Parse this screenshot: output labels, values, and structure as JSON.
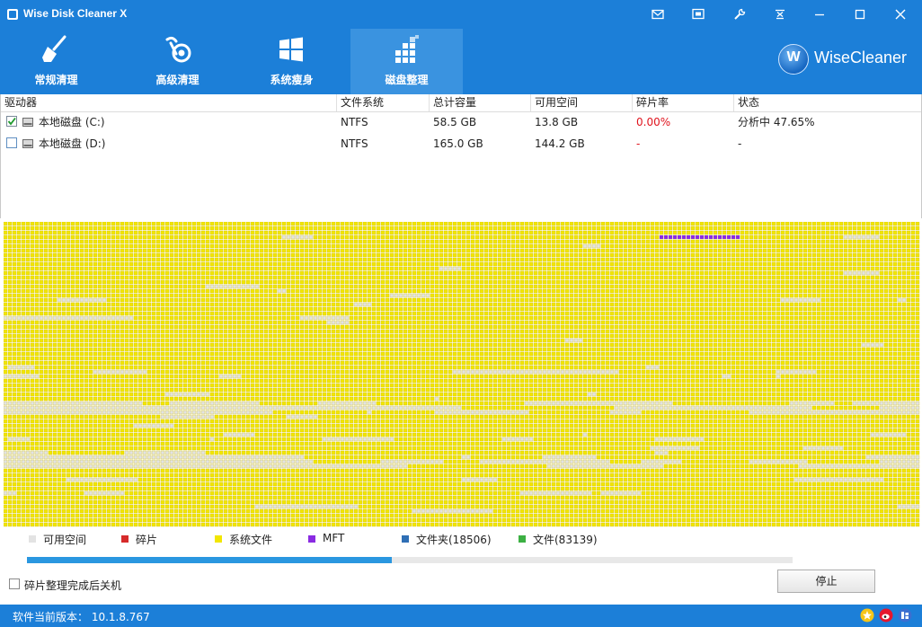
{
  "window": {
    "title": "Wise Disk Cleaner X",
    "controls": [
      "mail-icon",
      "feedback-icon",
      "tools-icon",
      "menu-icon",
      "minimize-icon",
      "maximize-icon",
      "close-icon"
    ]
  },
  "tabs": [
    {
      "label": "常规清理",
      "icon": "broom-icon",
      "active": false
    },
    {
      "label": "高级清理",
      "icon": "vacuum-icon",
      "active": false
    },
    {
      "label": "系统瘦身",
      "icon": "windows-icon",
      "active": false
    },
    {
      "label": "磁盘整理",
      "icon": "defrag-icon",
      "active": true
    }
  ],
  "brand": {
    "logo_letter": "W",
    "name": "WiseCleaner"
  },
  "table": {
    "columns": [
      "驱动器",
      "文件系统",
      "总计容量",
      "可用空间",
      "碎片率",
      "状态"
    ],
    "rows": [
      {
        "checked": true,
        "drive": "本地磁盘 (C:)",
        "fs": "NTFS",
        "total": "58.5 GB",
        "free": "13.8 GB",
        "frag": "0.00%",
        "status": "分析中 47.65%"
      },
      {
        "checked": false,
        "drive": "本地磁盘 (D:)",
        "fs": "NTFS",
        "total": "165.0 GB",
        "free": "144.2 GB",
        "frag": "-",
        "status": "-"
      }
    ]
  },
  "legend": [
    {
      "label": "可用空间",
      "color": "#e3e3e3"
    },
    {
      "label": "碎片",
      "color": "#d62b2b"
    },
    {
      "label": "系统文件",
      "color": "#f2e600"
    },
    {
      "label": "MFT",
      "color": "#8a2be2"
    },
    {
      "label": "文件夹(18506)",
      "color": "#2f6fb5"
    },
    {
      "label": "文件(83139)",
      "color": "#3cb043"
    }
  ],
  "progress": {
    "value": 0.4765
  },
  "shutdown_option": {
    "label": "碎片整理完成后关机",
    "checked": false
  },
  "stop_button": {
    "label": "停止"
  },
  "statusbar": {
    "version": "软件当前版本： 10.1.8.767",
    "icons": [
      "rate-icon",
      "weibo-icon",
      "tieba-icon"
    ]
  },
  "colors": {
    "accent": "#1c7fd8",
    "used": "#f2e600",
    "free": "#e3e3e3",
    "mft": "#8a2be2",
    "frag_text": "#e0141e"
  }
}
